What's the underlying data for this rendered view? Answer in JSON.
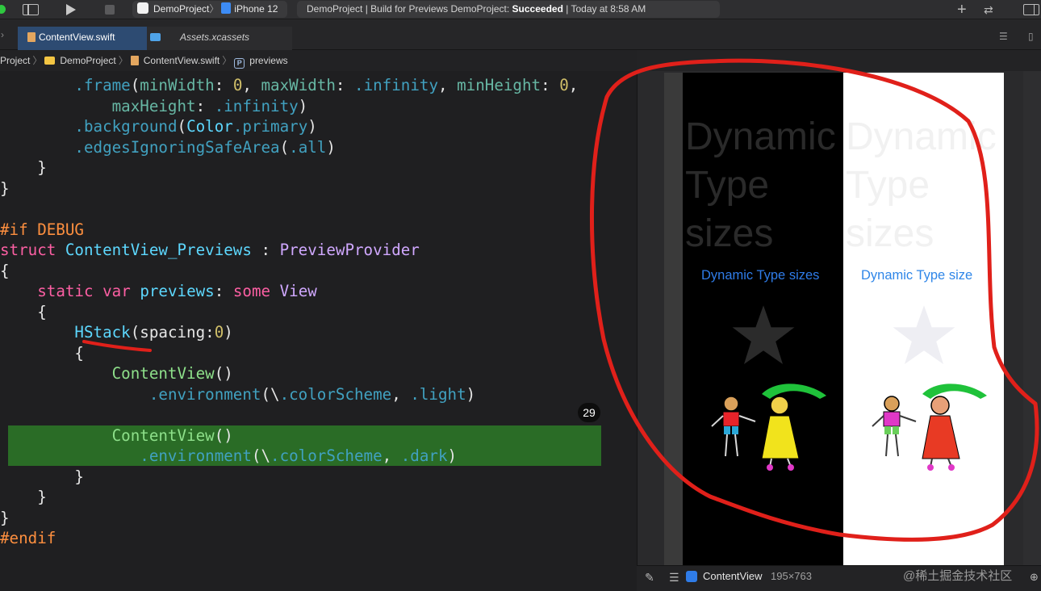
{
  "toolbar": {
    "scheme_project": "DemoProject",
    "scheme_separator": "〉",
    "scheme_device": "iPhone 12",
    "status_prefix": "DemoProject | Build for Previews DemoProject: ",
    "status_result": "Succeeded",
    "status_suffix": " | Today at 8:58 AM",
    "icons": [
      "sidebar-toggle-icon",
      "play-icon",
      "stop-icon",
      "plus-icon",
      "swap-icon",
      "panel-toggle-icon"
    ],
    "plus_glyph": "+",
    "swap_glyph": "⇄"
  },
  "tabs": {
    "chevron_glyph": "›",
    "items": [
      {
        "label": "ContentView.swift",
        "active": true
      },
      {
        "label": "Assets.xcassets",
        "active": false
      }
    ],
    "right_glyph_1": "☰",
    "right_glyph_2": "▯"
  },
  "breadcrumb": {
    "items": [
      "Project",
      "DemoProject",
      "ContentView.swift",
      "previews"
    ],
    "separator": "〉",
    "p_glyph": "P"
  },
  "editor": {
    "build_badge": "29"
  },
  "preview": {
    "dark_big_text": [
      "Dynamic",
      "Type",
      "sizes"
    ],
    "light_big_text": [
      "Dynamic",
      "Type",
      "sizes"
    ],
    "dark_small_text": "Dynamic Type sizes",
    "light_small_text": "Dynamic Type size"
  },
  "bottombar": {
    "pin_glyph": "✎",
    "list_glyph": "☰",
    "preview_name": "ContentView",
    "preview_size": "195×763",
    "watermark": "@稀土掘金技术社区",
    "zoom_glyph": "⊕"
  },
  "colors": {
    "accent_red_annotation": "#e0201a",
    "highlight_green": "#2a6c26",
    "swift_keyword": "#fc5fa3",
    "swift_type": "#5dd8ff",
    "swift_number": "#d0bf69",
    "preprocessor": "#fd8f3f",
    "link_blue": "#2f7ce8"
  }
}
